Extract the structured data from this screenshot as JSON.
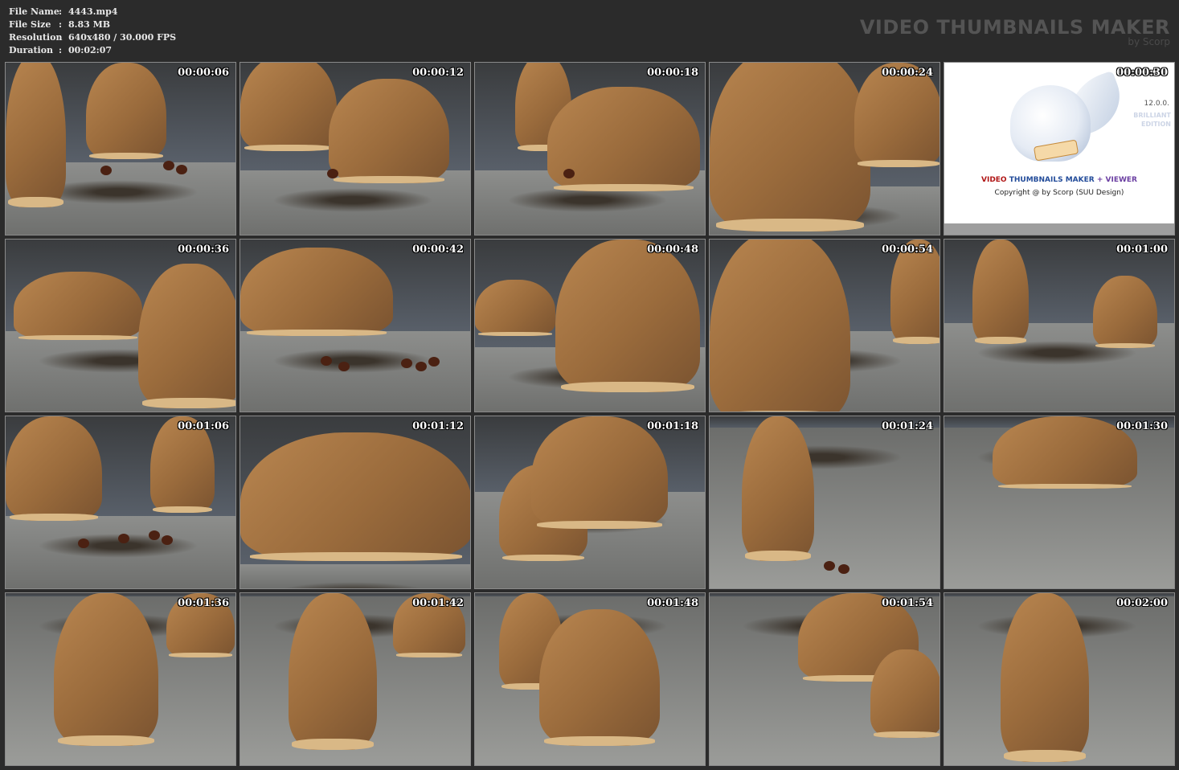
{
  "info": {
    "file_name_label": "File Name",
    "file_name": "4443.mp4",
    "file_size_label": "File Size",
    "file_size": "8.83 MB",
    "resolution_label": "Resolution",
    "resolution": "640x480 / 30.000 FPS",
    "duration_label": "Duration",
    "duration": "00:02:07",
    "separator": ":"
  },
  "brand": {
    "title": "VIDEO THUMBNAILS MAKER",
    "byline": "by Scorp"
  },
  "logo": {
    "version": "12.0.0.",
    "edition_line1": "BRILLIANT",
    "edition_line2": "EDITION",
    "product_part1": "VIDEO",
    "product_part2": "THUMBNAILS MAKER",
    "product_part3": "+ VIEWER",
    "copyright": "Copyright @ by Scorp (SUU Design)"
  },
  "thumbnails": [
    {
      "time": "00:00:06"
    },
    {
      "time": "00:00:12"
    },
    {
      "time": "00:00:18"
    },
    {
      "time": "00:00:24"
    },
    {
      "time": "00:00:30"
    },
    {
      "time": "00:00:36"
    },
    {
      "time": "00:00:42"
    },
    {
      "time": "00:00:48"
    },
    {
      "time": "00:00:54"
    },
    {
      "time": "00:01:00"
    },
    {
      "time": "00:01:06"
    },
    {
      "time": "00:01:12"
    },
    {
      "time": "00:01:18"
    },
    {
      "time": "00:01:24"
    },
    {
      "time": "00:01:30"
    },
    {
      "time": "00:01:36"
    },
    {
      "time": "00:01:42"
    },
    {
      "time": "00:01:48"
    },
    {
      "time": "00:01:54"
    },
    {
      "time": "00:02:00"
    }
  ],
  "colors": {
    "background": "#2b2b2b",
    "boot": "#a57444",
    "floor": "#8d8e8c"
  }
}
